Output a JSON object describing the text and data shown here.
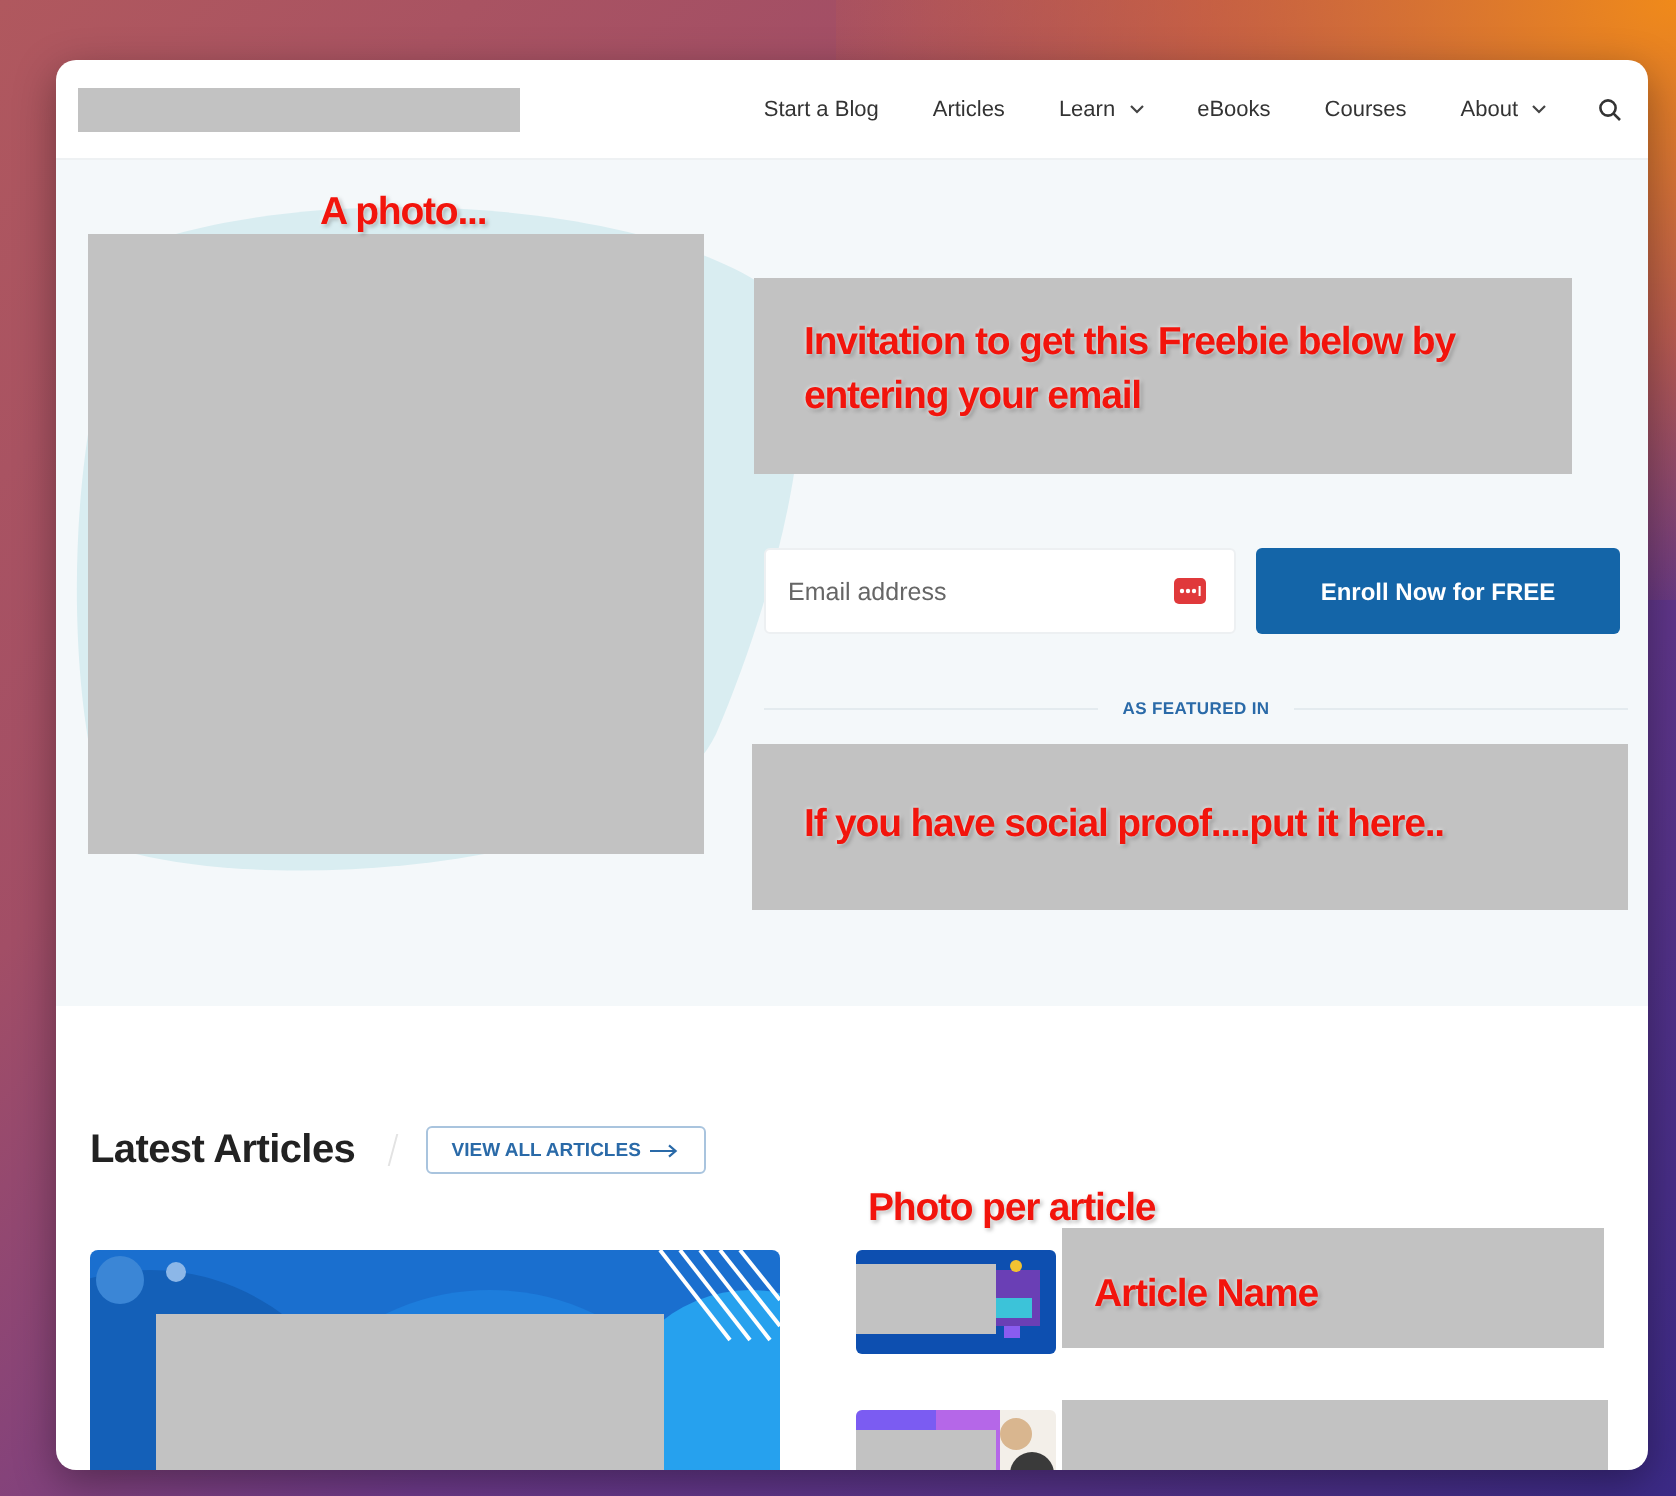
{
  "header": {
    "nav": [
      {
        "label": "Start a Blog",
        "has_menu": false
      },
      {
        "label": "Articles",
        "has_menu": false
      },
      {
        "label": "Learn",
        "has_menu": true
      },
      {
        "label": "eBooks",
        "has_menu": false
      },
      {
        "label": "Courses",
        "has_menu": false
      },
      {
        "label": "About",
        "has_menu": true
      }
    ]
  },
  "hero": {
    "photo_note": "A photo...",
    "invitation_note": "Invitation to get this Freebie below by entering your email",
    "email": {
      "placeholder": "Email address"
    },
    "enroll_button": "Enroll Now for FREE",
    "featured_label": "AS FEATURED IN",
    "social_proof_note": "If you have social proof....put it here.."
  },
  "latest": {
    "title": "Latest Articles",
    "view_all_button": "VIEW ALL ARTICLES",
    "photo_note": "Photo per article",
    "name_note": "Article Name"
  }
}
